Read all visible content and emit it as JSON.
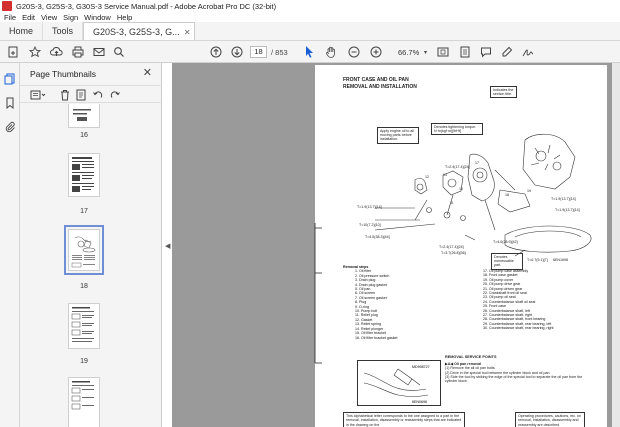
{
  "window": {
    "title": "G20S-3, G25S-3, G30S-3 Service Manual.pdf - Adobe Acrobat Pro DC (32-bit)",
    "accent": "#d32f2f"
  },
  "menu": [
    "File",
    "Edit",
    "View",
    "Sign",
    "Window",
    "Help"
  ],
  "tabs": {
    "home": "Home",
    "tools": "Tools",
    "document": "G20S-3, G25S-3, G..."
  },
  "toolbar": {
    "page_current": "18",
    "page_total": "/ 853",
    "zoom": "66.7%"
  },
  "panel": {
    "title": "Page Thumbnails",
    "thumbnails": [
      {
        "label": "16"
      },
      {
        "label": "17"
      },
      {
        "label": "18",
        "selected": true
      },
      {
        "label": "19"
      }
    ]
  },
  "pdf": {
    "heading_line1": "FRONT CASE AND OIL PAN",
    "heading_line2": "REMOVAL AND INSTALLATION",
    "callout_indicates": "Indicates the section title.",
    "callout_apply": "Apply engine oil to all moving parts before installation.",
    "callout_torque": "Denotes tightening torque. N·m(kgf·m)[lbf·ft]",
    "callout_nonreuse": "Denotes nonreusable part.",
    "ref_code": "6EN1698",
    "removal_steps_header": "Removal steps",
    "removal_steps_left": [
      "1. Oil filter",
      "2. Oil pressure switch",
      "3. Drain plug",
      "4. Drain plug gasket",
      "5. Oil pan",
      "6. Oil screen",
      "7. Oil screen gasket",
      "8. Plug",
      "9. O-ring",
      "10. Pump bolt",
      "11. Relief plug",
      "12. Gasket",
      "13. Relief spring",
      "14. Relief plunger",
      "15. Oil filter bracket",
      "16. Oil filter bracket gasket"
    ],
    "removal_steps_right": [
      "17. Oil pump case assembly",
      "18. Front case gasket",
      "19. Oil pump cover",
      "20. Oil pump drive gear",
      "21. Oil pump driven gear",
      "22. Crankshaft front oil seal",
      "23. Oil pump oil seal",
      "24. Counterbalance shaft oil seal",
      "25. Front case",
      "26. Counterbalance shaft, left",
      "27. Counterbalance shaft, right",
      "28. Counterbalance shaft, front bearing",
      "29. Counterbalance shaft, rear bearing, left",
      "30. Counterbalance shaft, rear bearing, right"
    ],
    "rsp_title": "REMOVAL SERVICE POINTS",
    "rsp_step": "▶A◀ Oil pan removal",
    "rsp_items": [
      "(1) Remove the all oil pan bolts.",
      "(2) Drive in the special tool between the cylinder block and oil pan.",
      "(3) Side the tool by striking the edge of the special tool to separate the oil pan from the cylinder block."
    ],
    "rsp_tool": "MD998727",
    "rsp_fig": "6EN0696",
    "bottom_left": "This alphabetical letter corresponds to the one assigned to a part in the removal, installation, disassembly or reassembly steps that are indicated in the drawing on the",
    "bottom_right": "Operating procedures, cautions, etc. on removal, installation, disassembly and reassembly are described"
  }
}
